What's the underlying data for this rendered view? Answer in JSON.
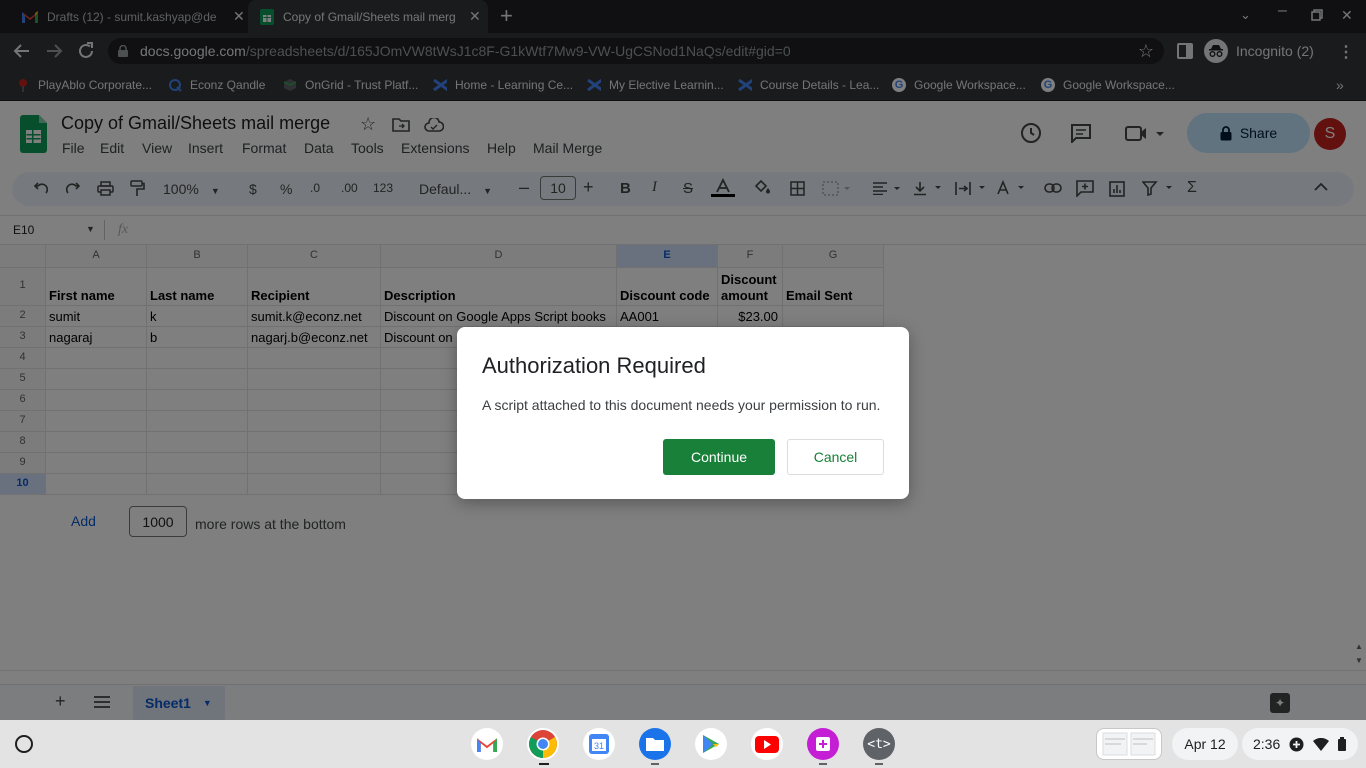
{
  "browser": {
    "tabs": [
      {
        "title": "Drafts (12) - sumit.kashyap@de",
        "icon": "gmail-icon"
      },
      {
        "title": "Copy of Gmail/Sheets mail merg",
        "icon": "sheets-icon"
      }
    ],
    "url_domain": "docs.google.com",
    "url_path": "/spreadsheets/d/165JOmVW8tWsJ1c8F-G1kWtf7Mw9-VW-UgCSNod1NaQs/edit#gid=0",
    "profile_label": "Incognito (2)",
    "bookmarks": [
      "PlayAblo Corporate...",
      "Econz Qandle",
      "OnGrid - Trust Platf...",
      "Home - Learning Ce...",
      "My Elective Learnin...",
      "Course Details - Lea...",
      "Google Workspace...",
      "Google Workspace..."
    ]
  },
  "sheets": {
    "doc_title": "Copy of Gmail/Sheets mail merge",
    "menu": [
      "File",
      "Edit",
      "View",
      "Insert",
      "Format",
      "Data",
      "Tools",
      "Extensions",
      "Help",
      "Mail Merge"
    ],
    "share_label": "Share",
    "avatar_letter": "S",
    "toolbar": {
      "zoom": "100%",
      "currency": "$",
      "percent": "%",
      "dec_decrease": ".0",
      "dec_increase": ".00",
      "number_format": "123",
      "font": "Defaul...",
      "font_size": "10"
    },
    "name_box": "E10",
    "fx_label": "fx",
    "columns": [
      "A",
      "B",
      "C",
      "D",
      "E",
      "F",
      "G"
    ],
    "rows": [
      "1",
      "2",
      "3",
      "4",
      "5",
      "6",
      "7",
      "8",
      "9",
      "10"
    ],
    "cells": {
      "a1": "First name",
      "b1": "Last name",
      "c1": "Recipient",
      "d1": "Description",
      "e1": "Discount code",
      "f1_line1": "Discount",
      "f1_line2": "amount",
      "g1": "Email Sent",
      "a2": "sumit",
      "b2": "k",
      "c2": "sumit.k@econz.net",
      "d2": "Discount on Google Apps Script books",
      "e2": "AA001",
      "f2": "$23.00",
      "a3": "nagaraj",
      "b3": "b",
      "c3": "nagarj.b@econz.net",
      "d3": "Discount on"
    },
    "add_label": "Add",
    "add_rows_value": "1000",
    "add_rows_suffix": "more rows at the bottom",
    "sheet_tab": "Sheet1"
  },
  "dialog": {
    "title": "Authorization Required",
    "message": "A script attached to this document needs your permission to run.",
    "continue_label": "Continue",
    "cancel_label": "Cancel"
  },
  "shelf": {
    "date": "Apr 12",
    "time": "2:36"
  },
  "colors": {
    "chrome_dark": "#202124",
    "chrome_tab": "#35363a",
    "sheets_green": "#188038",
    "share_bg": "#c2e7ff",
    "avatar": "#c5221f"
  }
}
